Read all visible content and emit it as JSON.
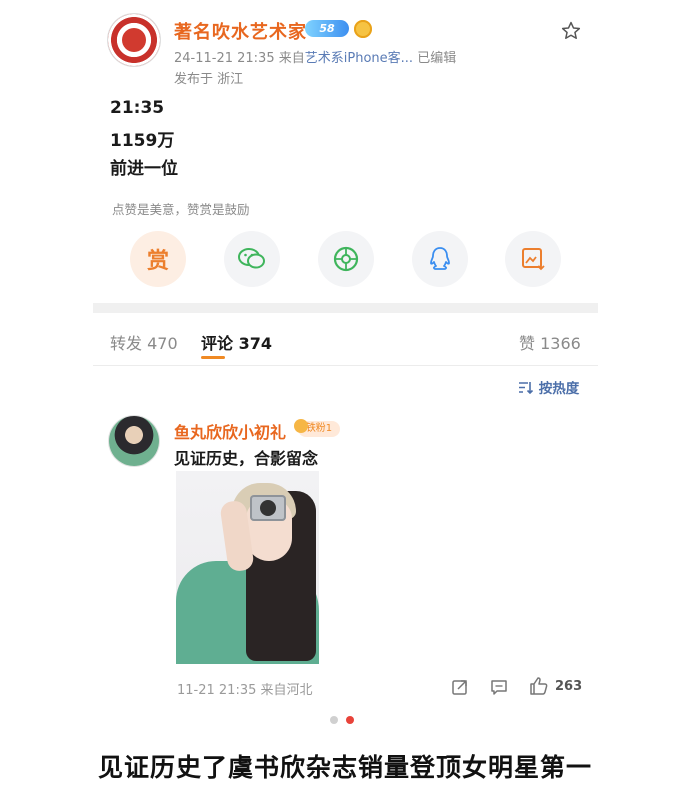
{
  "post": {
    "author": "著名吹水艺术家",
    "vip_level": "58",
    "meta": {
      "time": "24-11-21 21:35",
      "source_prefix": "来自",
      "source": "艺术系iPhone客...",
      "edited": "已编辑"
    },
    "location": "发布于 浙江",
    "lines": [
      "21:35",
      "1159万",
      "前进一位"
    ],
    "reward_tip": "点赞是美意，赞赏是鼓励",
    "reward_label": "赏"
  },
  "tabs": {
    "repost": "转发 470",
    "comment": "评论 374",
    "like": "赞 1366"
  },
  "sort_label": "按热度",
  "comment": {
    "author": "鱼丸欣欣小初礼",
    "fan_badge": "铁粉1",
    "text": "见证历史，合影留念",
    "meta": "11-21 21:35  来自河北",
    "likes": "263"
  },
  "colors": {
    "accent": "#e8671f",
    "link": "#4c6fa9",
    "page_dot_active": "#e8433a",
    "page_dot_inactive": "#d0d0d0"
  },
  "caption": "见证历史了虞书欣杂志销量登顶女明星第一"
}
